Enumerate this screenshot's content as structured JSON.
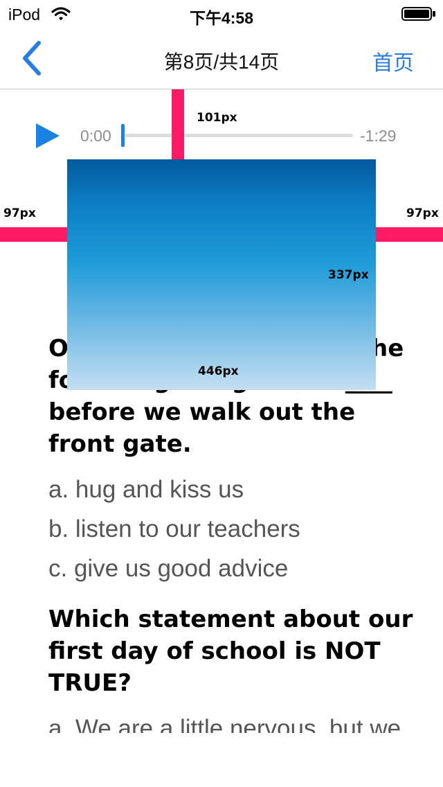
{
  "status_bar": {
    "carrier": "iPod",
    "time": "下午4:58",
    "icons": {
      "wifi": "wifi-icon",
      "battery": "battery-icon"
    }
  },
  "nav": {
    "back_icon": "chevron-left-icon",
    "title": "第8页/共14页",
    "home_label": "首页"
  },
  "audio": {
    "play_icon": "play-icon",
    "elapsed": "0:00",
    "remaining": "-1:29",
    "progress": 0
  },
  "ad_placeholder": {
    "top_label": "101px",
    "left_label": "97px",
    "right_label": "97px",
    "height_label": "337px",
    "width_label": "446px"
  },
  "questions": [
    {
      "text": "Our parents usually do the following things to us ____ before we walk out the front gate.",
      "options": [
        "a. hug and kiss us",
        "b. listen to our teachers",
        "c. give us good advice"
      ]
    },
    {
      "text": "Which statement about our first day of school is NOT TRUE?",
      "options": [
        "a. We are a little nervous, but we are also excited."
      ]
    }
  ],
  "colors": {
    "accent": "#2a7de1",
    "guide": "#ff1a66",
    "option_text": "#555555",
    "time_text": "#8e8e93"
  }
}
